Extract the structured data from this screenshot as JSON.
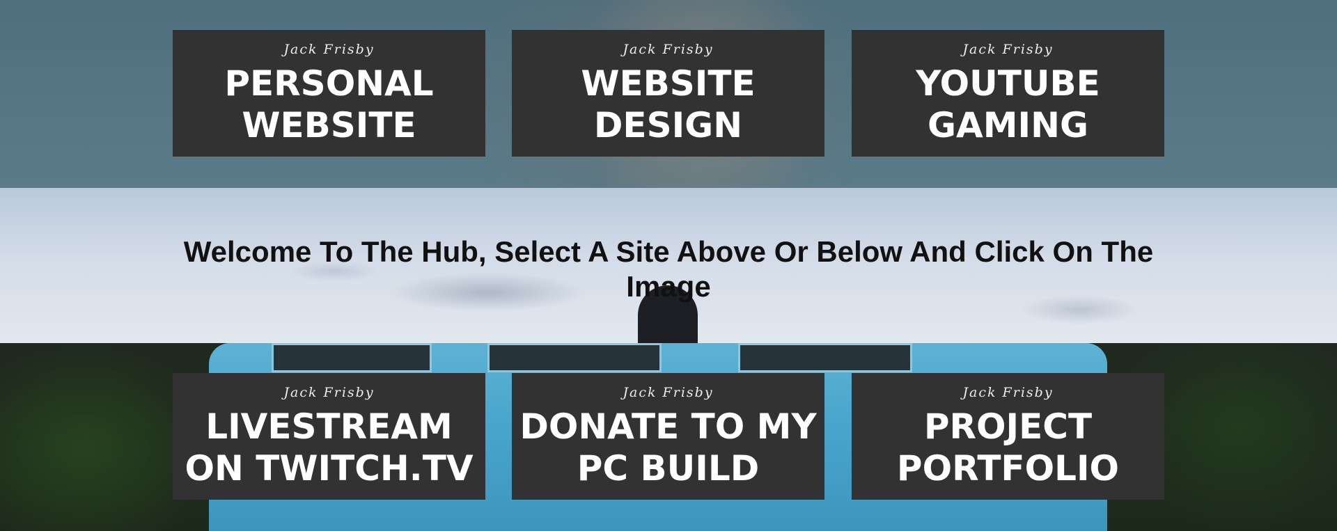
{
  "top_row": {
    "cards": [
      {
        "author": "Jack Frisby",
        "title": "PERSONAL\nWEBSITE"
      },
      {
        "author": "Jack Frisby",
        "title": "WEBSITE\nDESIGN"
      },
      {
        "author": "Jack Frisby",
        "title": "YOUTUBE\nGAMING"
      }
    ]
  },
  "hero": {
    "welcome_text": "Welcome To The Hub, Select A Site Above Or Below And Click On The Image"
  },
  "bottom_row": {
    "cards": [
      {
        "author": "Jack Frisby",
        "title": "LIVESTREAM\nON TWITCH.TV"
      },
      {
        "author": "Jack Frisby",
        "title": "DONATE TO MY\nPC BUILD"
      },
      {
        "author": "Jack Frisby",
        "title": "PROJECT\nPORTFOLIO"
      }
    ]
  },
  "colors": {
    "card_background": "#323232",
    "card_text": "#ffffff",
    "welcome_text": "#111111"
  }
}
